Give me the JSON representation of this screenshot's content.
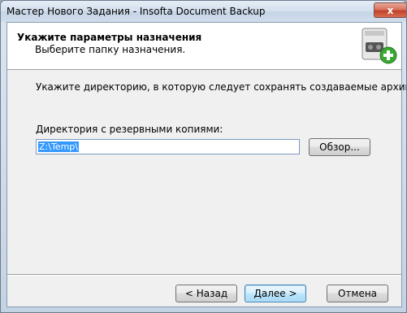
{
  "window": {
    "title": "Мастер Нового Задания - Insofta Document Backup",
    "close_glyph": "x"
  },
  "header": {
    "title": "Укажите параметры назначения",
    "subtitle": "Выберите папку назначения.",
    "icon": "backup-drive-add-icon"
  },
  "body": {
    "intro": "Укажите директорию, в которую следует сохранять создаваемые архивы.",
    "directory_label": "Директория с резервными копиями:",
    "directory_value": "Z:\\Temp\\",
    "browse_label": "Обзор..."
  },
  "footer": {
    "back_label": "< Назад",
    "next_label": "Далее >",
    "cancel_label": "Отмена"
  },
  "colors": {
    "selection": "#3399ff",
    "accent_green": "#3aa832"
  }
}
